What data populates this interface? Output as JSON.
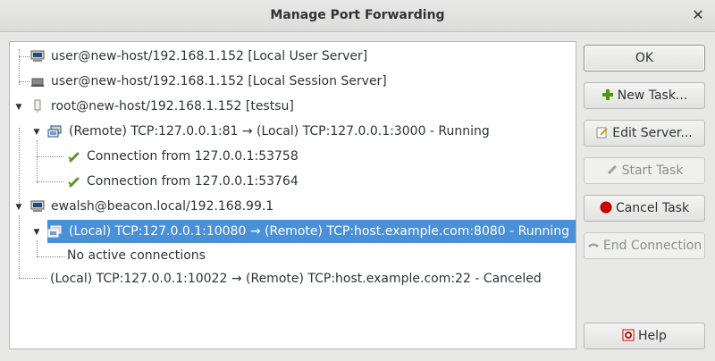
{
  "window": {
    "title": "Manage Port Forwarding",
    "close_glyph": "✕"
  },
  "tree": {
    "rows": [
      {
        "label": "user@new-host/192.168.1.152 [Local User Server]",
        "icon": "computer-icon"
      },
      {
        "label": "user@new-host/192.168.1.152 [Local Session Server]",
        "icon": "computer-icon"
      },
      {
        "label": "root@new-host/192.168.1.152 [testsu]",
        "icon": "server-tower-icon",
        "expanded": true
      },
      {
        "label": "(Remote) TCP:127.0.0.1:81 → (Local) TCP:127.0.0.1:3000 - Running",
        "icon": "forward-task-icon",
        "expanded": true
      },
      {
        "label": "Connection from 127.0.0.1:53758",
        "icon": "connection-check-icon"
      },
      {
        "label": "Connection from 127.0.0.1:53764",
        "icon": "connection-check-icon"
      },
      {
        "label": "ewalsh@beacon.local/192.168.99.1",
        "icon": "computer-icon",
        "expanded": true
      },
      {
        "label": "(Local) TCP:127.0.0.1:10080 → (Remote) TCP:host.example.com:8080 - Running",
        "icon": "forward-task-icon",
        "expanded": true,
        "selected": true
      },
      {
        "label": "No active connections"
      },
      {
        "label": "(Local) TCP:127.0.0.1:10022 → (Remote) TCP:host.example.com:22 - Canceled"
      }
    ]
  },
  "buttons": {
    "ok": "OK",
    "new_task": "New Task...",
    "edit_server": "Edit Server...",
    "start_task": "Start Task",
    "cancel_task": "Cancel Task",
    "end_connection": "End Connection",
    "help": "Help"
  },
  "colors": {
    "selection": "#4a90d9",
    "cancel_red": "#cc0000",
    "add_green": "#4e9a06"
  }
}
